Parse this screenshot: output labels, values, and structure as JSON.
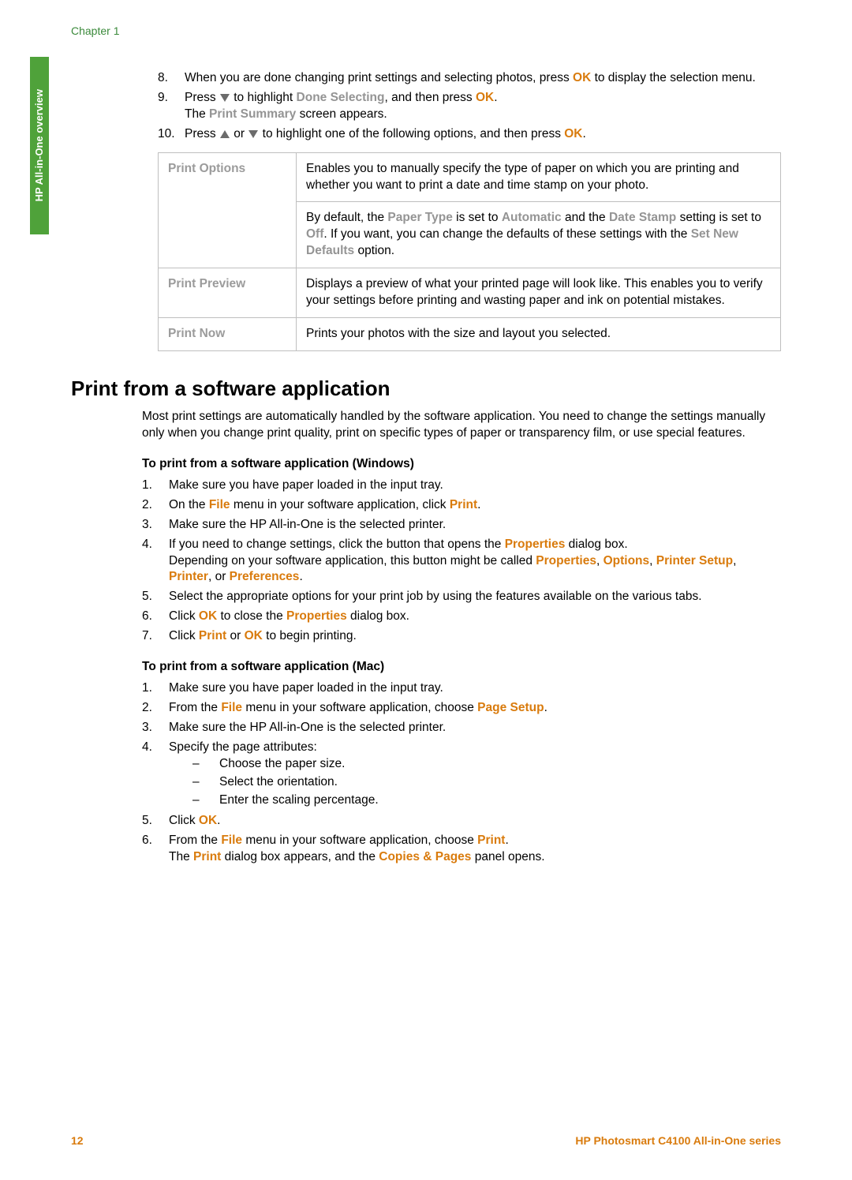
{
  "chapter": "Chapter 1",
  "side_tab": "HP All-in-One overview",
  "steps_a": {
    "s8": {
      "num": "8.",
      "t1": "When you are done changing print settings and selecting photos, press ",
      "ok": "OK",
      "t2": " to display the selection menu."
    },
    "s9": {
      "num": "9.",
      "t1": "Press ",
      "t2": " to highlight ",
      "done": "Done Selecting",
      "t3": ", and then press ",
      "ok": "OK",
      "t4": ".",
      "line2a": "The ",
      "ps": "Print Summary",
      "line2b": " screen appears."
    },
    "s10": {
      "num": "10.",
      "t1": "Press ",
      "t2": " or ",
      "t3": " to highlight one of the following options, and then press ",
      "ok": "OK",
      "t4": "."
    }
  },
  "table": {
    "r1": {
      "label": "Print Options",
      "p1": "Enables you to manually specify the type of paper on which you are printing and whether you want to print a date and time stamp on your photo.",
      "p2a": "By default, the ",
      "pt": "Paper Type",
      "p2b": " is set to ",
      "auto": "Automatic",
      "p2c": " and the ",
      "ds": "Date Stamp",
      "p2d": " setting is set to ",
      "off": "Off",
      "p2e": ". If you want, you can change the defaults of these settings with the ",
      "snd": "Set New Defaults",
      "p2f": " option."
    },
    "r2": {
      "label": "Print Preview",
      "desc": "Displays a preview of what your printed page will look like. This enables you to verify your settings before printing and wasting paper and ink on potential mistakes."
    },
    "r3": {
      "label": "Print Now",
      "desc": "Prints your photos with the size and layout you selected."
    }
  },
  "heading": "Print from a software application",
  "intro": "Most print settings are automatically handled by the software application. You need to change the settings manually only when you change print quality, print on specific types of paper or transparency film, or use special features.",
  "win": {
    "title": "To print from a software application (Windows)",
    "s1": {
      "num": "1.",
      "t": "Make sure you have paper loaded in the input tray."
    },
    "s2": {
      "num": "2.",
      "a": "On the ",
      "file": "File",
      "b": " menu in your software application, click ",
      "print": "Print",
      "c": "."
    },
    "s3": {
      "num": "3.",
      "t": "Make sure the HP All-in-One is the selected printer."
    },
    "s4": {
      "num": "4.",
      "a": "If you need to change settings, click the button that opens the ",
      "prop": "Properties",
      "b": " dialog box.",
      "c": "Depending on your software application, this button might be called ",
      "prop2": "Properties",
      "d": ", ",
      "opt": "Options",
      "e": ", ",
      "psu": "Printer Setup",
      "f": ", ",
      "pr": "Printer",
      "g": ", or ",
      "pref": "Preferences",
      "h": "."
    },
    "s5": {
      "num": "5.",
      "t": "Select the appropriate options for your print job by using the features available on the various tabs."
    },
    "s6": {
      "num": "6.",
      "a": "Click ",
      "ok": "OK",
      "b": " to close the ",
      "prop": "Properties",
      "c": " dialog box."
    },
    "s7": {
      "num": "7.",
      "a": "Click ",
      "print": "Print",
      "b": " or ",
      "ok": "OK",
      "c": " to begin printing."
    }
  },
  "mac": {
    "title": "To print from a software application (Mac)",
    "s1": {
      "num": "1.",
      "t": "Make sure you have paper loaded in the input tray."
    },
    "s2": {
      "num": "2.",
      "a": "From the ",
      "file": "File",
      "b": " menu in your software application, choose ",
      "ps": "Page Setup",
      "c": "."
    },
    "s3": {
      "num": "3.",
      "t": "Make sure the HP All-in-One is the selected printer."
    },
    "s4": {
      "num": "4.",
      "t": "Specify the page attributes:",
      "sub1": "Choose the paper size.",
      "sub2": "Select the orientation.",
      "sub3": "Enter the scaling percentage."
    },
    "s5": {
      "num": "5.",
      "a": "Click ",
      "ok": "OK",
      "b": "."
    },
    "s6": {
      "num": "6.",
      "a": "From the ",
      "file": "File",
      "b": " menu in your software application, choose ",
      "print": "Print",
      "c": ".",
      "l2a": "The ",
      "pr": "Print",
      "l2b": " dialog box appears, and the ",
      "cp": "Copies & Pages",
      "l2c": " panel opens."
    }
  },
  "footer": {
    "page": "12",
    "series": "HP Photosmart C4100 All-in-One series"
  }
}
